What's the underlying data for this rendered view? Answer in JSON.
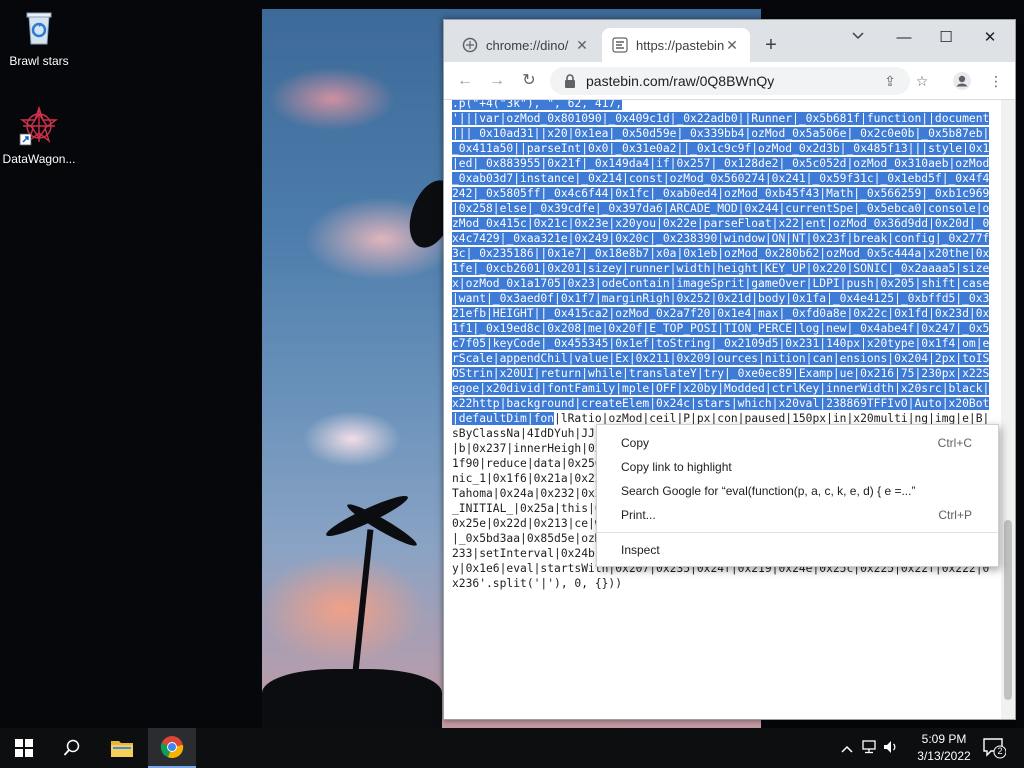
{
  "desktop": {
    "icons": [
      {
        "label": "Brawl stars",
        "icon": "recycle-bin-icon"
      },
      {
        "label": "DataWagon...",
        "icon": "datawagon-shortcut-icon"
      }
    ]
  },
  "browser": {
    "tabs": [
      {
        "title": "chrome://dino/",
        "icon": "puzzle-icon",
        "close": "✕"
      },
      {
        "title": "https://pastebin",
        "icon": "pastebin-icon",
        "close": "✕"
      }
    ],
    "new_tab": "+",
    "tab_search": "⌄",
    "window_controls": {
      "minimize": "—",
      "maximize": "☐",
      "close": "✕"
    },
    "nav": {
      "back": "←",
      "forward": "→",
      "reload": "↻"
    },
    "url": "pastebin.com/raw/0Q8BWnQy",
    "toolbar_icons": {
      "share": "⇪",
      "star": "☆",
      "profile": "●",
      "menu": "⋮"
    }
  },
  "code": {
    "selected": ".p(\"+4(\"3k\"), \", 62, 417,\n'|||var|ozMod_0x801090|_0x409c1d|_0x22adb0||Runner|_0x5b681f|function||document|||_0x10ad31||x20|0x1ea|_0x50d59e|_0x339bb4|ozMod_0x5a506e|_0x2c0e0b|_0x5b87eb|_0x411a50||parseInt|0x0|_0x31e0a2||_0x1c9c9f|ozMod_0x2d3b|_0x485f13|||style|0x1|ed|_0x883955|0x21f|_0x149da4|if|0x257|_0x128de2|_0x5c052d|ozMod_0x310aeb|ozMod_0xab03d7|instance|_0x214|const|ozMod_0x560274|0x241|_0x59f31c|_0x1ebd5f|_0x4f4242|_0x5805ff|_0x4c6f44|0x1fc|_0xab0ed4|ozMod_0xb45f43|Math|_0x566259|_0xb1c969|0x258|else|_0x39cdfe|_0x397da6|ARCADE_MOD|0x244|currentSpe|_0x5ebca0|console|ozMod_0x415c|0x21c|0x23e|x20you|0x22e|parseFloat|x22|ent|ozMod_0x36d9dd|0x20d|_0x4c7429|_0xaa321e|0x249|0x20c|_0x238390|window|ON|NT|0x23f|break|config|_0x277f3c|_0x235186||0x1e7|_0x18e8b7|x0a|0x1eb|ozMod_0x280b62|ozMod_0x5c444a|x20the|0x1fe|_0xcb2601|0x201|sizey|runner|width|height|KEY_UP|0x220|SONIC|_0x2aaaa5|sizex|ozMod_0x1a1705|0x23|odeContain|imageSprit|gameOver|LDPI|push|0x205|shift|case|want|_0x3aed0f|0x1f7|marginRigh|0x252|0x21d|body|0x1fa|_0x4e4125|_0xbffd5|_0x321efb|HEIGHT||_0x415ca2|ozMod_0x2a7f20|0x1e4|max|_0xfd0a8e|0x22c|0x1fd|0x23d|0x1f1|_0x19ed8c|0x208|me|0x20f|E_TOP_POSI|TION_PERCE|log|new|_0x4abe4f|0x247|_0x5c7f05|keyCode|_0x455345|0x1ef|toString|_0x2109d5|0x231|140px|x20type|0x1f4|om|erScale|appendChil|value|Ex|0x211|0x209|ources|nition|can|ensions|0x204|2px|toISOStrin|x20UI|return|while|translateY|try|_0xe0ec89|Examp|ue|0x216|75|230px|x22Segoe|x20divid|fontFamily|mple|OFF|x20by|Modded|ctrlKey|innerWidth|x20src|black|x22http|background|createElem|0x24c|stars|which|x20val|238869TFFIvO|Auto|x20Bot|defaultDim|fon",
    "unselected": "|lRatio|ozMod|ceil|P|px|con|paused|150px|in|x20multi|ng|img|e|B|sByClassNa|4IdDYuh|JJcS|nter|438048ZMVT|0If|734335WXheZw|shi|xb|Din|5px|onclick|b|0x237|innerHeigh|0x20e|0x239|Event|setTimeout|0x210|0x203|0x224|Date|jump|0x1f90|reduce|data|0x256|ta|0x1ee|getContext|0x217|vas|0x22a|0x215|0x26|0x1f2|oSonic_1|0x1f6|0x21a|0x227|0x229|0x223|0x218|0x24d|0x243|0x25b|id|0x234|0x253||x20Tahoma|0x24a|0x232|0x230|0x23b|0x21b|0x1e9|0x1f3|0x23c|0x25d|0x254|TOP_POSITI|E_INITIAL_|0x25a|this|0x21e|an|0x64|0x228|0x1e5|prompt|x20Speed|Set|0x23a|0x1fb|0x25e|0x22d|0x213|ce|webkit|0x246|white|0x259|Color|ply|0x221|0x1ec|0x250|catch|_0x5bd3aa|0x85d5e|ozMod_0x367b1d|0x1f9|0x226|switch|0x20b|0x1f5|0x240|0x238|0x233|setInterval|0x24b|x20sp|0x202|0x251|0x212|0x242|0x1e8|0x248|x20So|x20As|Play|0x1e6|eval|startsWith|0x207|0x235|0x24f|0x219|0x24e|0x25c|0x225|0x22f|0x222|0x236'.split('|'), 0, {}))"
  },
  "context_menu": {
    "items": [
      {
        "label": "Copy",
        "shortcut": "Ctrl+C"
      },
      {
        "label": "Copy link to highlight",
        "shortcut": ""
      },
      {
        "label": "Search Google for “eval(function(p, a, c, k, e, d) {      e =...”",
        "shortcut": ""
      },
      {
        "label": "Print...",
        "shortcut": "Ctrl+P"
      },
      {
        "label": "Inspect",
        "shortcut": ""
      }
    ]
  },
  "taskbar": {
    "time": "5:09 PM",
    "date": "3/13/2022",
    "notification_count": "2",
    "tray": {
      "chevron": "^",
      "network": "⊡",
      "volume": "🔈"
    }
  },
  "colors": {
    "selection": "#3e7bd6",
    "tabstrip": "#dee1e6",
    "taskbar": "#0d0e10"
  }
}
